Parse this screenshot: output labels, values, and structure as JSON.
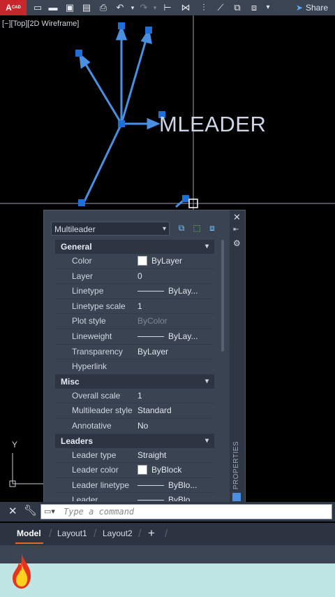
{
  "app": {
    "logo_text": "A",
    "logo_sub": "CAD",
    "share_label": "Share"
  },
  "viewport": {
    "label": "[−][Top][2D Wireframe]",
    "annotation_text": "MLEADER",
    "ucs_y_label": "Y"
  },
  "palette": {
    "object_type": "Multileader",
    "side_label": "PROPERTIES",
    "sections": [
      {
        "title": "General",
        "rows": [
          {
            "name": "Color",
            "value": "ByLayer",
            "swatch": "#ffffff"
          },
          {
            "name": "Layer",
            "value": "0"
          },
          {
            "name": "Linetype",
            "value": "ByLay...",
            "line": true
          },
          {
            "name": "Linetype scale",
            "value": "1"
          },
          {
            "name": "Plot style",
            "value": "ByColor",
            "dim": true
          },
          {
            "name": "Lineweight",
            "value": "ByLay...",
            "line": true
          },
          {
            "name": "Transparency",
            "value": "ByLayer"
          },
          {
            "name": "Hyperlink",
            "value": ""
          }
        ]
      },
      {
        "title": "Misc",
        "rows": [
          {
            "name": "Overall scale",
            "value": "1"
          },
          {
            "name": "Multileader style",
            "value": "Standard"
          },
          {
            "name": "Annotative",
            "value": "No"
          }
        ]
      },
      {
        "title": "Leaders",
        "rows": [
          {
            "name": "Leader type",
            "value": "Straight"
          },
          {
            "name": "Leader color",
            "value": "ByBlock",
            "swatch": "#ffffff"
          },
          {
            "name": "Leader linetype",
            "value": "ByBlo...",
            "line": true
          },
          {
            "name": "Leader lineweight",
            "value": "ByBlo...",
            "line": true
          }
        ]
      }
    ]
  },
  "command": {
    "placeholder": "Type a command"
  },
  "tabs": {
    "model": "Model",
    "layout1": "Layout1",
    "layout2": "Layout2",
    "add": "+"
  },
  "colors": {
    "accent_blue": "#3d8be0",
    "leader_blue": "#4a90e2",
    "logo_red": "#c8262b"
  },
  "icons": [
    "new-icon",
    "open-icon",
    "save-icon",
    "saveas-icon",
    "print-icon",
    "undo-icon",
    "redo-icon",
    "share-icon",
    "close-icon",
    "wrench-icon",
    "fire-icon"
  ]
}
